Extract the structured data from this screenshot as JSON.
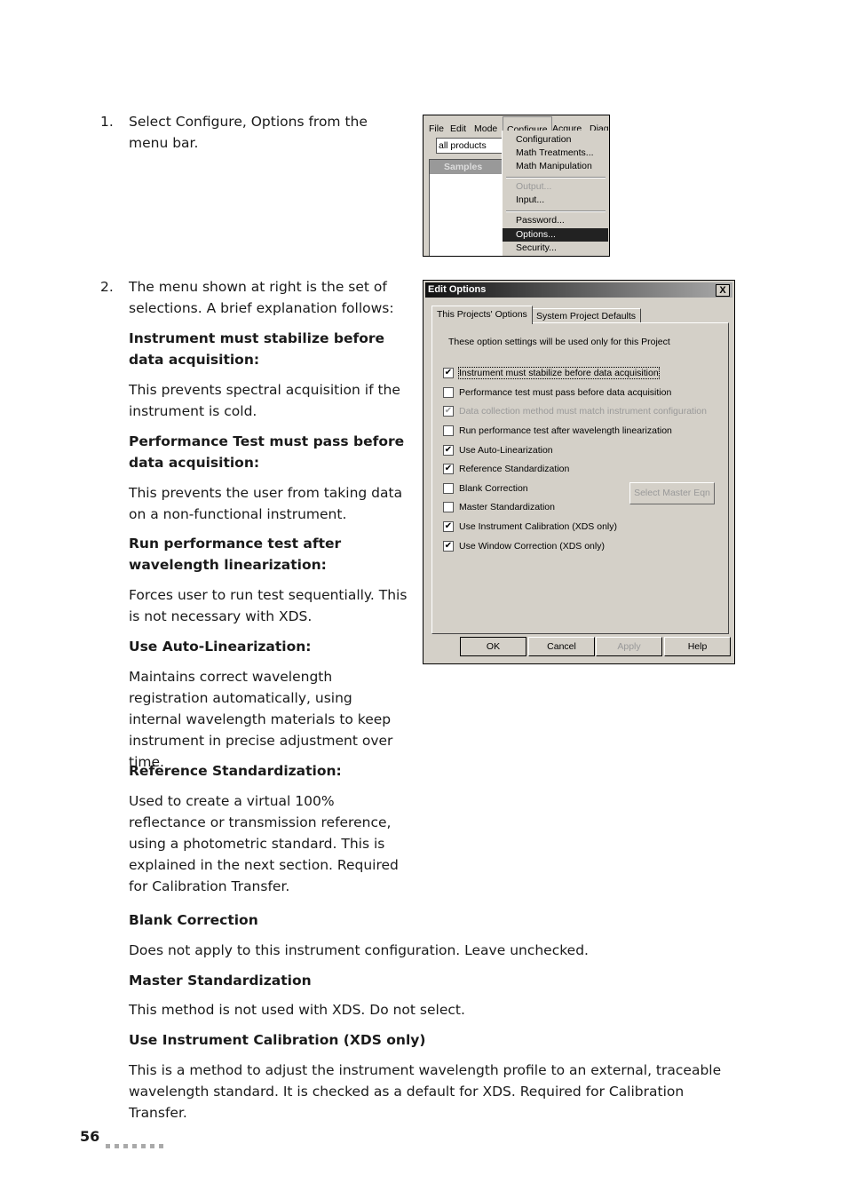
{
  "steps": [
    {
      "num": "1.",
      "text": "Select Configure, Options from the menu bar."
    },
    {
      "num": "2.",
      "text": "The menu shown at right is the set of selections. A brief explanation follows:"
    }
  ],
  "explanations": [
    {
      "heading": "Instrument must stabilize before data acquisition:",
      "body": "This prevents spectral acquisition if the instrument is cold."
    },
    {
      "heading": "Performance Test must pass before data acquisition:",
      "body": "This prevents the user from taking data on a non-functional instrument."
    },
    {
      "heading": "Run performance test after wavelength linearization:",
      "body": "Forces user to run test sequentially. This is not necessary with XDS."
    },
    {
      "heading": "Use Auto-Linearization:",
      "body": "Maintains correct wavelength registration automatically, using internal wavelength materials to keep instrument in precise adjustment over time."
    },
    {
      "heading": "Reference Standardization:",
      "body": "Used to create a virtual 100% reflectance or transmission reference, using a photometric standard. This is explained in the next section. Required for Calibration Transfer."
    },
    {
      "heading": "Blank Correction",
      "body": "Does not apply to this instrument configuration. Leave unchecked."
    },
    {
      "heading": "Master Standardization",
      "body": "This method is not used with XDS. Do not select."
    },
    {
      "heading": "Use Instrument Calibration (XDS only)",
      "body": "This is a method to adjust the instrument wavelength profile to an external, traceable wavelength standard. It is checked as a default for XDS. Required for Calibration Transfer."
    }
  ],
  "menu_shot": {
    "menubar": [
      "File",
      "Edit",
      "Mode",
      "Configure",
      "Acqure",
      "Diagn"
    ],
    "combo": "all products",
    "window_title": "Samples",
    "items": [
      {
        "label": "Configuration",
        "state": "normal"
      },
      {
        "label": "Math Treatments...",
        "state": "normal"
      },
      {
        "label": "Math Manipulation",
        "state": "normal"
      },
      {
        "label": "Output...",
        "state": "disabled"
      },
      {
        "label": "Input...",
        "state": "normal"
      },
      {
        "label": "Password...",
        "state": "normal"
      },
      {
        "label": "Options...",
        "state": "highlighted"
      },
      {
        "label": "Security...",
        "state": "normal"
      }
    ]
  },
  "dialog": {
    "title": "Edit Options",
    "close": "X",
    "tabs": [
      "This Projects' Options",
      "System Project Defaults"
    ],
    "info": "These option settings will be used only for this Project",
    "options": [
      {
        "label": "Instrument must stabilize before data acquisition",
        "checked": true
      },
      {
        "label": "Performance test must pass before data acquisition",
        "checked": false
      },
      {
        "label": "Data collection method must match instrument configuration",
        "checked": true,
        "disabled": true
      },
      {
        "label": "Run performance test after wavelength linearization",
        "checked": false
      },
      {
        "label": "Use Auto-Linearization",
        "checked": true
      },
      {
        "label": "Reference Standardization",
        "checked": true
      },
      {
        "label": "Blank Correction",
        "checked": false
      },
      {
        "label": "Master Standardization",
        "checked": false
      },
      {
        "label": "Use Instrument Calibration (XDS only)",
        "checked": true
      },
      {
        "label": "Use Window Correction (XDS only)",
        "checked": true
      }
    ],
    "select_master": "Select Master Eqn",
    "buttons": [
      "OK",
      "Cancel",
      "Apply",
      "Help"
    ]
  },
  "footer": {
    "page": "56"
  }
}
